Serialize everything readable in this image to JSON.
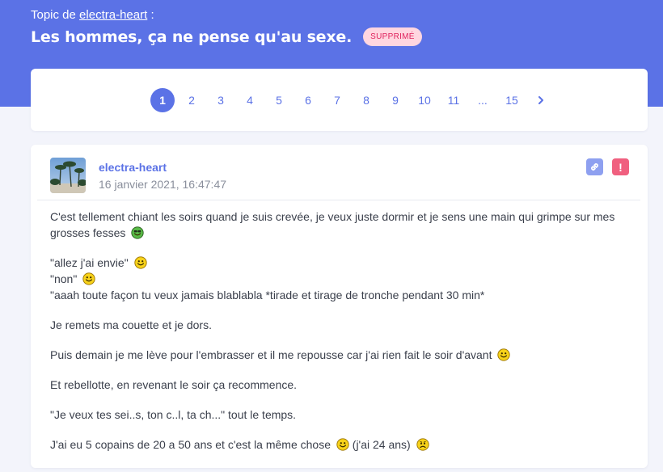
{
  "header": {
    "topic_prefix": "Topic de",
    "topic_author": "electra-heart",
    "topic_suffix": ":",
    "title": "Les hommes, ça ne pense qu'au sexe.",
    "badge": "SUPPRIMÉ"
  },
  "pagination": {
    "pages": [
      "1",
      "2",
      "3",
      "4",
      "5",
      "6",
      "7",
      "8",
      "9",
      "10",
      "11",
      "...",
      "15"
    ],
    "active": "1",
    "next_icon": "chevron-right-icon"
  },
  "post": {
    "author": "electra-heart",
    "date": "16 janvier 2021, 16:47:47",
    "actions": {
      "link_icon": "link-icon",
      "report_label": "!"
    },
    "paragraphs": [
      {
        "lines": [
          {
            "text": "C'est tellement chiant les soirs quand je suis crevée, je veux juste dormir et je sens une main qui grimpe sur mes grosses fesses",
            "smiley": "green"
          }
        ]
      },
      {
        "lines": [
          {
            "text": "\"allez j'ai envie\"",
            "smiley": "yellow"
          },
          {
            "text": "\"non\"",
            "smiley": "yellow"
          },
          {
            "text": "\"aaah toute façon tu veux jamais blablabla *tirade et tirage de tronche pendant 30 min*",
            "smiley": ""
          }
        ]
      },
      {
        "lines": [
          {
            "text": "Je remets ma couette et je dors.",
            "smiley": ""
          }
        ]
      },
      {
        "lines": [
          {
            "text": "Puis demain je me lève pour l'embrasser et il me repousse car j'ai rien fait le soir d'avant",
            "smiley": "yellow"
          }
        ]
      },
      {
        "lines": [
          {
            "text": "Et rebellotte, en revenant le soir ça recommence.",
            "smiley": ""
          }
        ]
      },
      {
        "lines": [
          {
            "text": "\"Je veux tes sei..s, ton c..l, ta ch...\" tout le temps.",
            "smiley": ""
          }
        ]
      },
      {
        "lines": [
          {
            "text": "J'ai eu 5 copains de 20 a 50 ans et c'est la même chose",
            "smiley": "yellow",
            "after": "(j'ai 24 ans)",
            "after_smiley": "worried"
          }
        ]
      }
    ]
  },
  "colors": {
    "primary": "#5b72e6",
    "badge_bg": "#ffd6e0",
    "badge_text": "#e0245e",
    "report": "#f0607f"
  }
}
